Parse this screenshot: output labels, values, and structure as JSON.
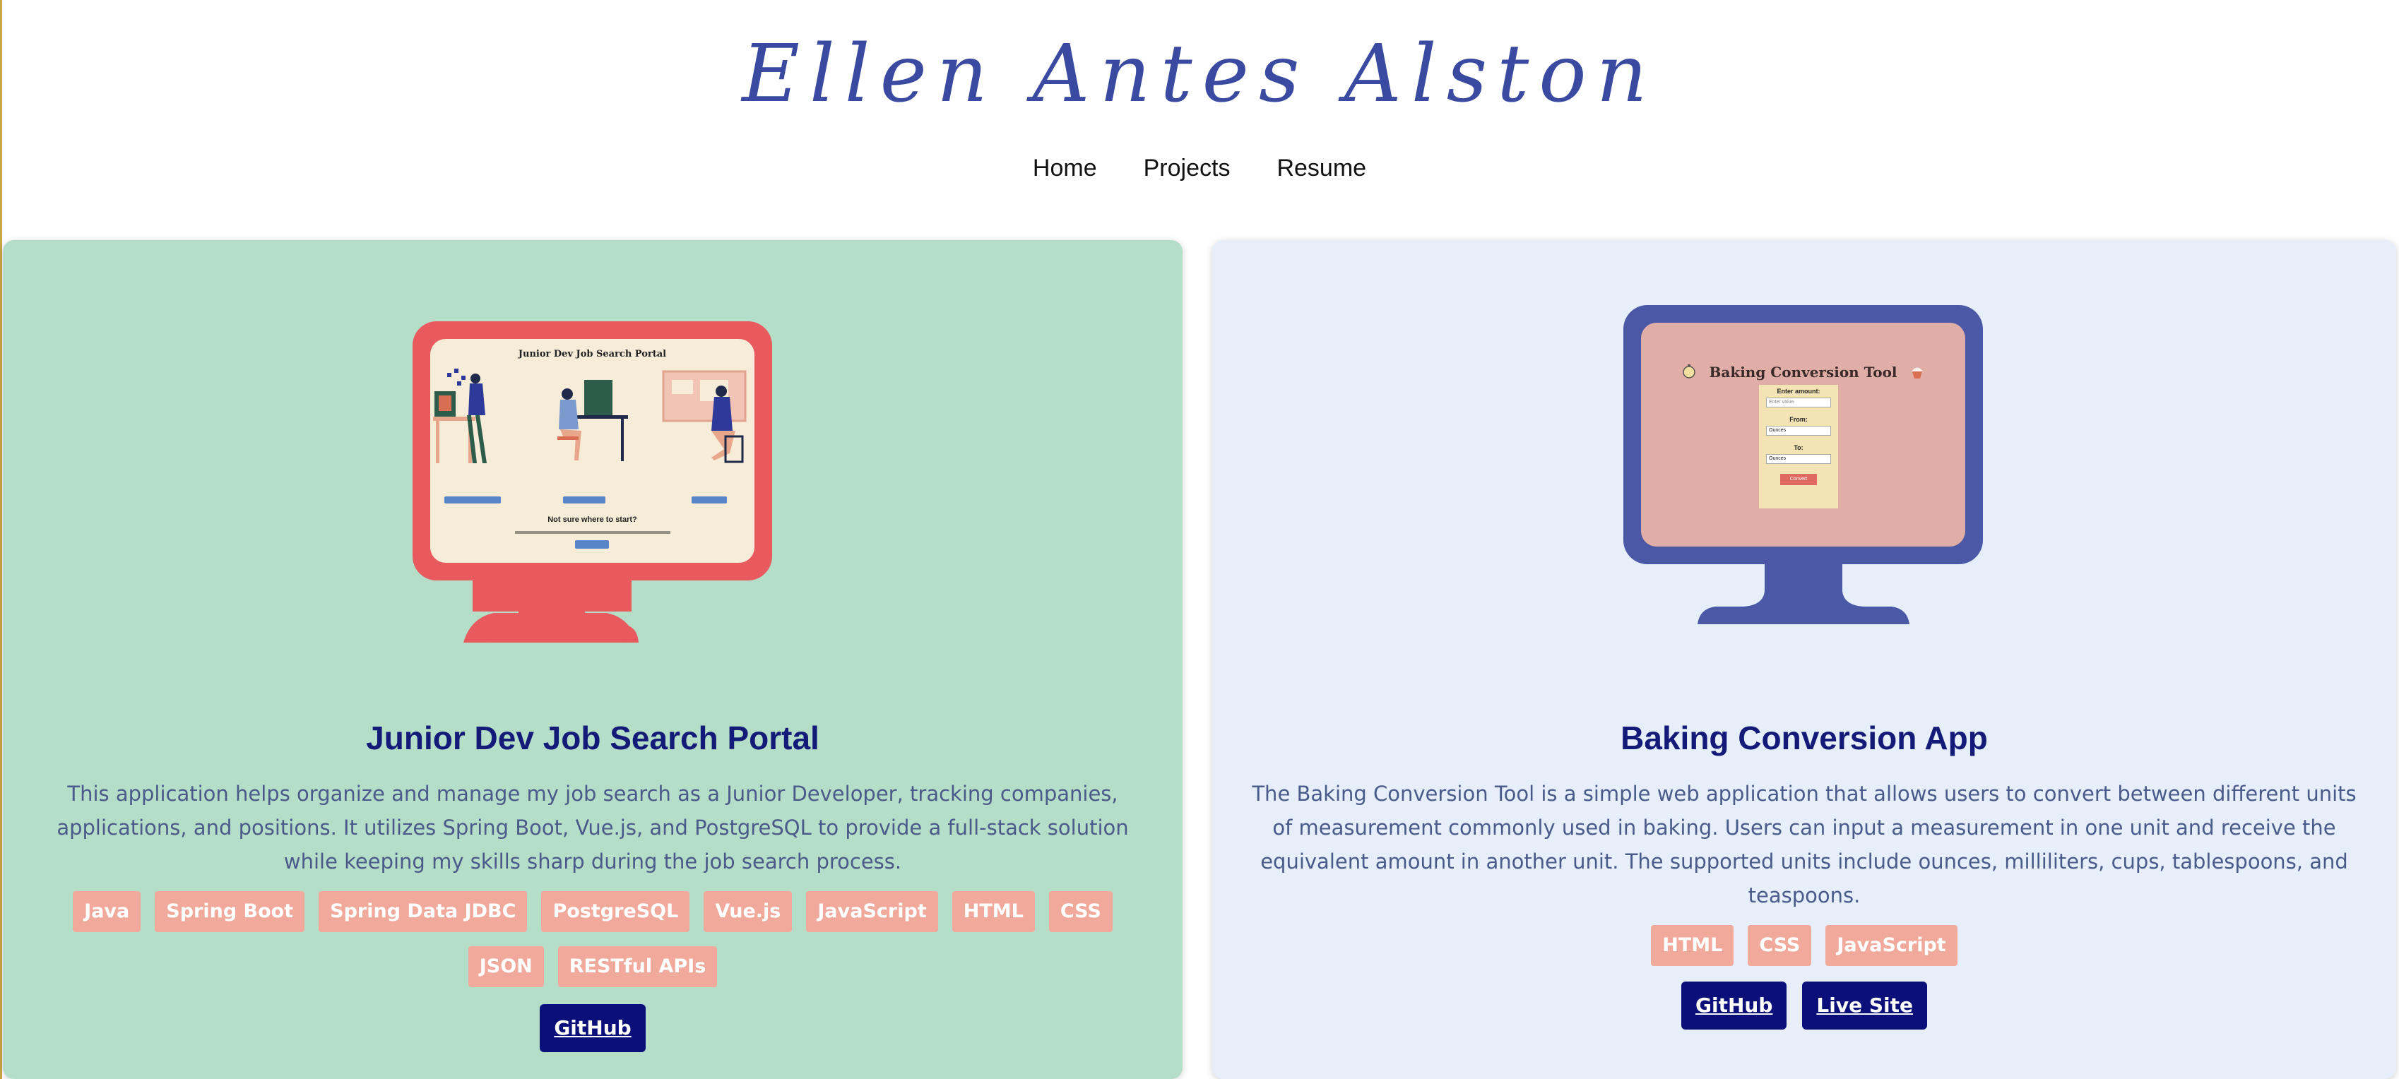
{
  "site": {
    "title": "Ellen Antes Alston"
  },
  "nav": {
    "items": [
      {
        "label": "Home"
      },
      {
        "label": "Projects"
      },
      {
        "label": "Resume"
      }
    ]
  },
  "projects": [
    {
      "title": "Junior Dev Job Search Portal",
      "screen_title": "Junior Dev Job Search Portal",
      "screen_subheading": "Not sure where to start?",
      "description": "This application helps organize and manage my job search as a Junior Developer, tracking companies, applications, and positions. It utilizes Spring Boot, Vue.js, and PostgreSQL to provide a full-stack solution while keeping my skills sharp during the job search process.",
      "tags": [
        "Java",
        "Spring Boot",
        "Spring Data JDBC",
        "PostgreSQL",
        "Vue.js",
        "JavaScript",
        "HTML",
        "CSS",
        "JSON",
        "RESTful APIs"
      ],
      "buttons": [
        "GitHub"
      ],
      "monitor_color": "#e85a5e"
    },
    {
      "title": "Baking Conversion App",
      "screen_title": "Baking Conversion Tool",
      "screen_labels": [
        "Enter amount:",
        "From:",
        "To:"
      ],
      "screen_input_placeholder": "Enter value",
      "screen_options": [
        "Ounces",
        "Ounces"
      ],
      "screen_button": "Convert",
      "description": "The Baking Conversion Tool is a simple web application that allows users to convert between different units of measurement commonly used in baking. Users can input a measurement in one unit and receive the equivalent amount in another unit. The supported units include ounces, milliliters, cups, tablespoons, and teaspoons.",
      "tags": [
        "HTML",
        "CSS",
        "JavaScript"
      ],
      "buttons": [
        "GitHub",
        "Live Site"
      ],
      "monitor_color": "#4b58a6"
    }
  ],
  "colors": {
    "title": "#3a4aa0",
    "card_left_bg": "#b5dec8",
    "card_right_bg": "#e5eef9",
    "tag_bg": "#f0a99b",
    "button_bg": "#0b0f7a",
    "heading": "#141a78"
  }
}
